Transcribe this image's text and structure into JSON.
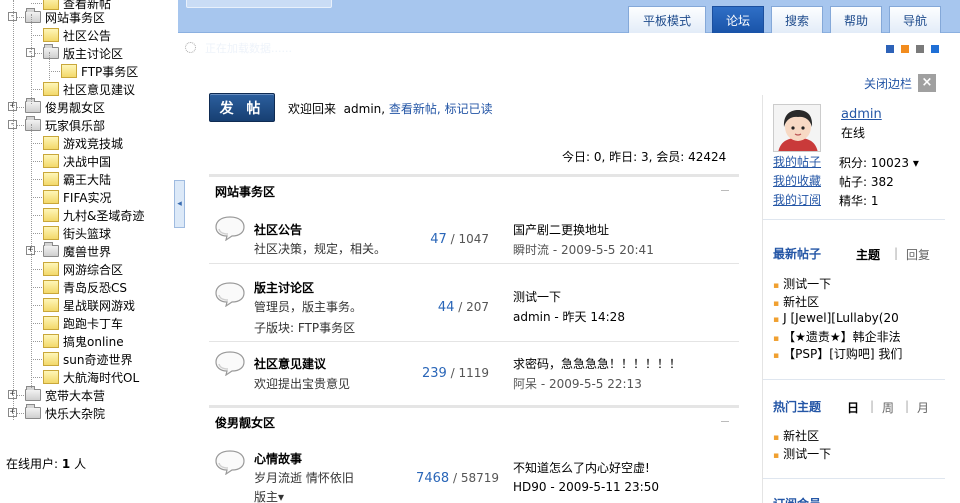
{
  "tree": {
    "items": [
      {
        "label": "查看新帖",
        "level": 1,
        "icon": "doc"
      },
      {
        "label": "网站事务区",
        "level": 0,
        "icon": "gray",
        "toggle": "-"
      },
      {
        "label": "社区公告",
        "level": 1,
        "icon": "doc"
      },
      {
        "label": "版主讨论区",
        "level": 1,
        "icon": "gray",
        "toggle": "-"
      },
      {
        "label": "FTP事务区",
        "level": 2,
        "icon": "doc"
      },
      {
        "label": "社区意见建议",
        "level": 1,
        "icon": "doc"
      },
      {
        "label": "俊男靓女区",
        "level": 0,
        "icon": "gray",
        "toggle": "+"
      },
      {
        "label": "玩家俱乐部",
        "level": 0,
        "icon": "gray",
        "toggle": "-"
      },
      {
        "label": "游戏竞技城",
        "level": 1,
        "icon": "doc"
      },
      {
        "label": "决战中国",
        "level": 1,
        "icon": "doc"
      },
      {
        "label": "霸王大陆",
        "level": 1,
        "icon": "doc"
      },
      {
        "label": "FIFA实况",
        "level": 1,
        "icon": "doc"
      },
      {
        "label": "九村&圣域奇迹",
        "level": 1,
        "icon": "doc"
      },
      {
        "label": "街头篮球",
        "level": 1,
        "icon": "doc"
      },
      {
        "label": "魔兽世界",
        "level": 1,
        "icon": "gray",
        "toggle": "+"
      },
      {
        "label": "网游综合区",
        "level": 1,
        "icon": "doc"
      },
      {
        "label": "青岛反恐CS",
        "level": 1,
        "icon": "doc"
      },
      {
        "label": "星战联网游戏",
        "level": 1,
        "icon": "doc"
      },
      {
        "label": "跑跑卡丁车",
        "level": 1,
        "icon": "doc"
      },
      {
        "label": "搞鬼online",
        "level": 1,
        "icon": "doc"
      },
      {
        "label": "sun奇迹世界",
        "level": 1,
        "icon": "doc"
      },
      {
        "label": "大航海时代OL",
        "level": 1,
        "icon": "doc"
      },
      {
        "label": "宽带大本营",
        "level": 0,
        "icon": "gray",
        "toggle": "+"
      },
      {
        "label": "快乐大杂院",
        "level": 0,
        "icon": "gray",
        "toggle": "+"
      }
    ],
    "online_label": "在线用户:",
    "online_count": "1",
    "online_unit": "人"
  },
  "nav": {
    "tabs": [
      {
        "label": "平板模式",
        "active": false
      },
      {
        "label": "论坛",
        "active": true
      },
      {
        "label": "搜索",
        "active": false
      },
      {
        "label": "帮助",
        "active": false
      },
      {
        "label": "导航",
        "active": false
      }
    ]
  },
  "toolbar": {
    "loading_text": "正在加载数据......",
    "skin_colors": [
      "#2d62b8",
      "#f28c1e",
      "#7a7a7a",
      "#1f6fd6"
    ],
    "close_sidebar": "关闭边栏",
    "close_x": "×"
  },
  "welcome": {
    "post_button": "发 帖",
    "greeting": "欢迎回来",
    "username": "admin,",
    "link_new": "查看新帖,",
    "link_mark": "标记已读"
  },
  "stats": "今日: 0, 昨日: 3, 会员: 42424",
  "sections": [
    {
      "title": "网站事务区",
      "forums": [
        {
          "name": "社区公告",
          "desc": "社区决策，规定，相关。",
          "desc2": "",
          "topics": "47",
          "posts": "/ 1047",
          "last_title": "国产剧二更换地址",
          "last_meta": "瞬时流  - 2009-5-5 20:41"
        },
        {
          "name": "版主讨论区",
          "desc": "管理员，版主事务。",
          "desc2": "子版块: FTP事务区",
          "topics": "44",
          "posts": "/ 207",
          "last_title": "测试一下",
          "last_meta": "admin - 昨天 14:28"
        },
        {
          "name": "社区意见建议",
          "desc": "欢迎提出宝贵意见",
          "desc2": "",
          "topics": "239",
          "posts": "/ 1119",
          "last_title": "求密码，急急急急！！！！！！",
          "last_meta": "阿呆  - 2009-5-5 22:13"
        }
      ]
    },
    {
      "title": "俊男靓女区",
      "forums": [
        {
          "name": "心情故事",
          "desc": "岁月流逝 情怀依旧",
          "desc2": "版主▾",
          "topics": "7468",
          "posts": "/ 58719",
          "last_title": "不知道怎么了内心好空虚!",
          "last_meta": "HD90 - 2009-5-11 23:50"
        }
      ]
    }
  ],
  "sidebar": {
    "username": "admin",
    "status": "在线",
    "links": [
      "我的帖子",
      "我的收藏",
      "我的订阅"
    ],
    "stats": [
      "积分: 10023 ▾",
      "帖子: 382",
      "精华: 1"
    ],
    "new_posts": {
      "title": "最新帖子",
      "tab_on": "主题",
      "tab_off": "回复",
      "items": [
        "测试一下",
        "新社区",
        "J [Jewel][Lullaby(20",
        "【★遗责★】韩企非法",
        "【PSP】[订购吧] 我们"
      ]
    },
    "hot_topics": {
      "title": "热门主题",
      "tabs": [
        "日",
        "周",
        "月"
      ],
      "items": [
        "新社区",
        "测试一下"
      ]
    },
    "next_title": "订阅会员"
  }
}
